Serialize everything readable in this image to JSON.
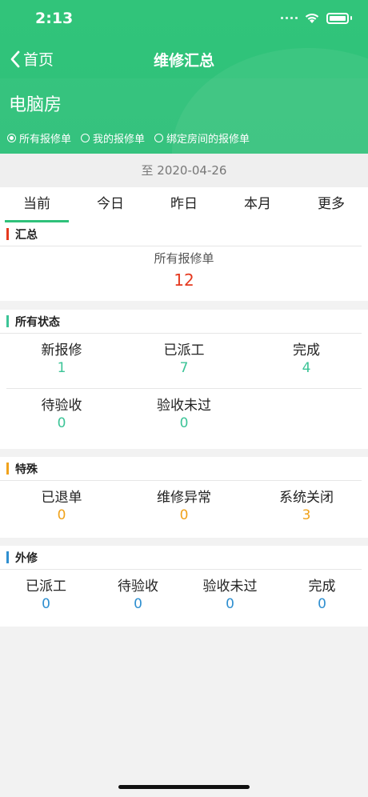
{
  "status_bar": {
    "time": "2:13"
  },
  "nav": {
    "back_label": "首页",
    "title": "维修汇总"
  },
  "room": {
    "name": "电脑房"
  },
  "filters": [
    {
      "label": "所有报修单",
      "selected": true
    },
    {
      "label": "我的报修单",
      "selected": false
    },
    {
      "label": "绑定房间的报修单",
      "selected": false
    }
  ],
  "date_range": {
    "text": "至 2020-04-26"
  },
  "tabs": [
    {
      "label": "当前",
      "active": true
    },
    {
      "label": "今日",
      "active": false
    },
    {
      "label": "昨日",
      "active": false
    },
    {
      "label": "本月",
      "active": false
    },
    {
      "label": "更多",
      "active": false
    }
  ],
  "colors": {
    "header_green": "#2fc17a",
    "summary_accent": "#e5391f",
    "status_accent": "#3cc497",
    "special_accent": "#f0a21b",
    "external_accent": "#2f8fd0"
  },
  "summary": {
    "title": "汇总",
    "label": "所有报修单",
    "value": "12"
  },
  "all_status": {
    "title": "所有状态",
    "row1": [
      {
        "label": "新报修",
        "value": "1"
      },
      {
        "label": "已派工",
        "value": "7"
      },
      {
        "label": "完成",
        "value": "4"
      }
    ],
    "row2": [
      {
        "label": "待验收",
        "value": "0"
      },
      {
        "label": "验收未过",
        "value": "0"
      }
    ]
  },
  "special": {
    "title": "特殊",
    "items": [
      {
        "label": "已退单",
        "value": "0"
      },
      {
        "label": "维修异常",
        "value": "0"
      },
      {
        "label": "系统关闭",
        "value": "3"
      }
    ]
  },
  "external": {
    "title": "外修",
    "items": [
      {
        "label": "已派工",
        "value": "0"
      },
      {
        "label": "待验收",
        "value": "0"
      },
      {
        "label": "验收未过",
        "value": "0"
      },
      {
        "label": "完成",
        "value": "0"
      }
    ]
  }
}
